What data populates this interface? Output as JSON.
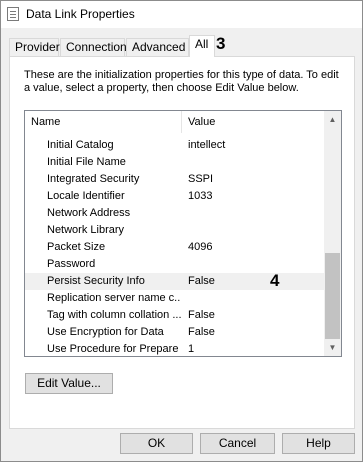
{
  "window": {
    "title": "Data Link Properties"
  },
  "tabs": [
    {
      "label": "Provider"
    },
    {
      "label": "Connection"
    },
    {
      "label": "Advanced"
    },
    {
      "label": "All",
      "active": true
    }
  ],
  "annotations": {
    "tab_marker": "3",
    "row_marker": "4"
  },
  "panel": {
    "description": "These are the initialization properties for this type of data. To edit a value, select a property, then choose Edit Value below.",
    "columns": {
      "name": "Name",
      "value": "Value"
    },
    "rows": [
      {
        "name": "Initial Catalog",
        "value": "intellect"
      },
      {
        "name": "Initial File Name",
        "value": ""
      },
      {
        "name": "Integrated Security",
        "value": "SSPI"
      },
      {
        "name": "Locale Identifier",
        "value": "1033"
      },
      {
        "name": "Network Address",
        "value": ""
      },
      {
        "name": "Network Library",
        "value": ""
      },
      {
        "name": "Packet Size",
        "value": "4096"
      },
      {
        "name": "Password",
        "value": ""
      },
      {
        "name": "Persist Security Info",
        "value": "False",
        "selected": true
      },
      {
        "name": "Replication server name c...",
        "value": ""
      },
      {
        "name": "Tag with column collation ...",
        "value": "False"
      },
      {
        "name": "Use Encryption for Data",
        "value": "False"
      },
      {
        "name": "Use Procedure for Prepare",
        "value": "1"
      }
    ],
    "edit_button": "Edit Value..."
  },
  "footer": {
    "ok": "OK",
    "cancel": "Cancel",
    "help": "Help"
  },
  "icons": {
    "app": "document-icon",
    "scroll_up": "scroll-up-arrow-icon",
    "scroll_down": "scroll-down-arrow-icon"
  }
}
